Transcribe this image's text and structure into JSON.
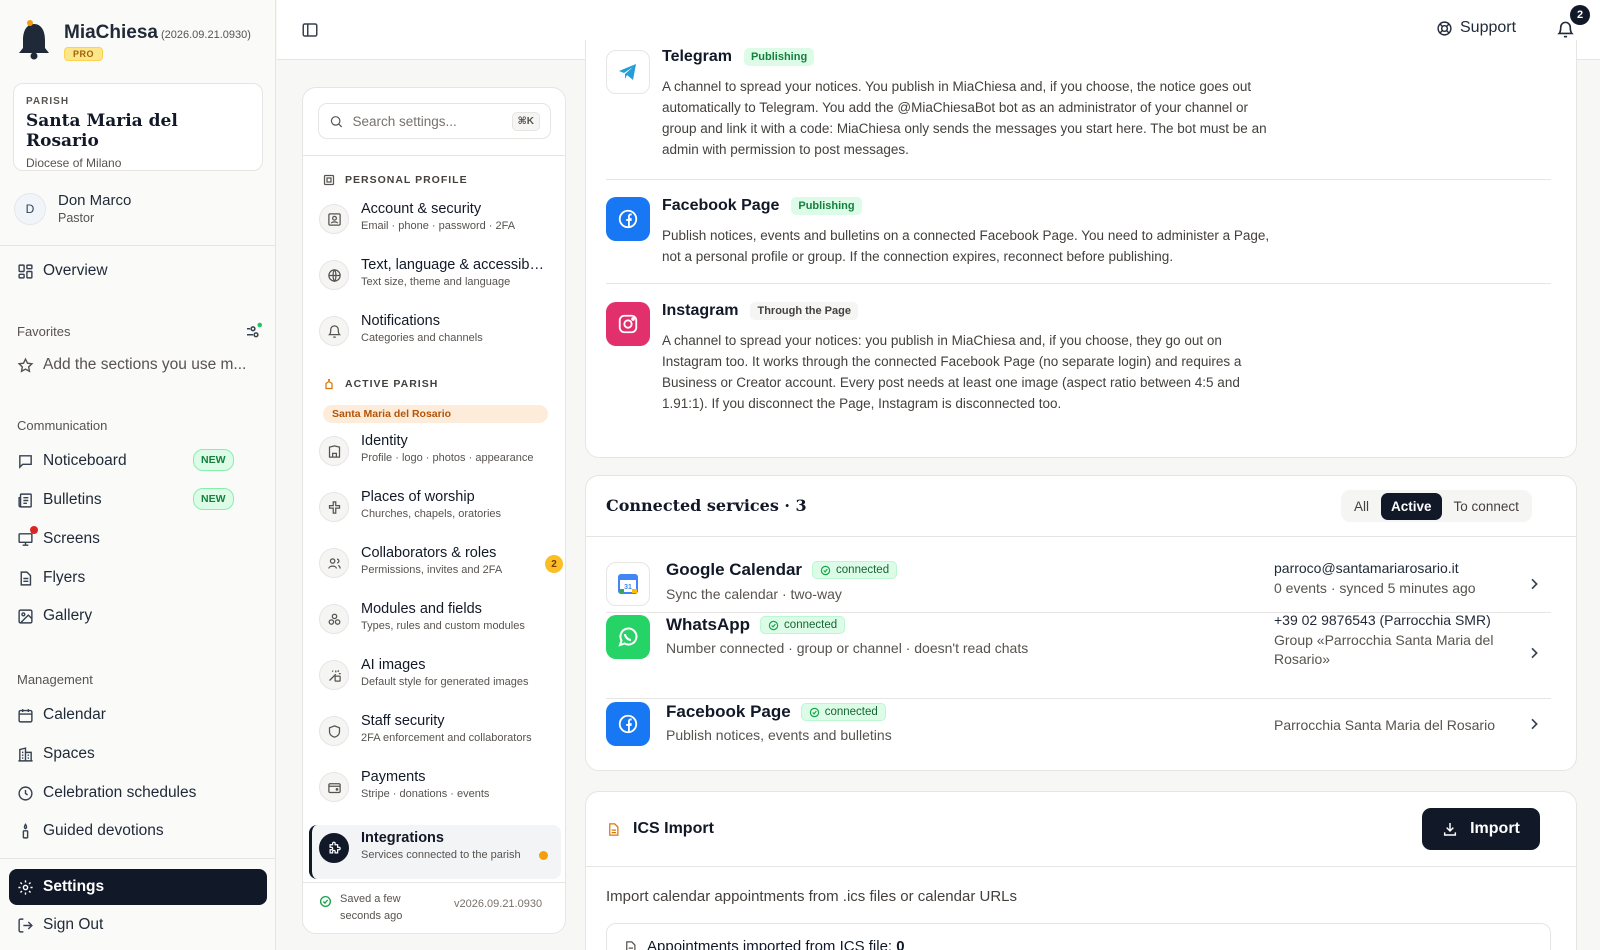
{
  "app": {
    "name": "MiaChiesa",
    "version": "(2026.09.21.0930)",
    "plan": "PRO"
  },
  "parish": {
    "label": "PARISH",
    "name": "Santa Maria del Rosario",
    "diocese": "Diocese of Milano"
  },
  "user": {
    "initial": "D",
    "name": "Don Marco",
    "role": "Pastor"
  },
  "nav": {
    "overview": "Overview",
    "favorites_label": "Favorites",
    "favorites_hint": "Add the sections you use m...",
    "communication_label": "Communication",
    "communication": [
      {
        "label": "Noticeboard",
        "badge": "NEW"
      },
      {
        "label": "Bulletins",
        "badge": "NEW"
      },
      {
        "label": "Screens"
      },
      {
        "label": "Flyers"
      },
      {
        "label": "Gallery"
      }
    ],
    "management_label": "Management",
    "management": [
      {
        "label": "Calendar"
      },
      {
        "label": "Spaces"
      },
      {
        "label": "Celebration schedules"
      },
      {
        "label": "Guided devotions"
      }
    ],
    "settings": "Settings",
    "signout": "Sign Out"
  },
  "topbar": {
    "support": "Support",
    "notifications_count": "2"
  },
  "settings_panel": {
    "search_placeholder": "Search settings...",
    "shortcut": "⌘K",
    "personal_label": "PERSONAL PROFILE",
    "personal": [
      {
        "title": "Account & security",
        "sub": "Email · phone · password · 2FA"
      },
      {
        "title": "Text, language & accessibility",
        "sub": "Text size, theme and language"
      },
      {
        "title": "Notifications",
        "sub": "Categories and channels"
      }
    ],
    "parish_label": "ACTIVE PARISH",
    "parish_tag": "Santa Maria del Rosario",
    "parish_items": [
      {
        "title": "Identity",
        "sub": "Profile · logo · photos · appearance"
      },
      {
        "title": "Places of worship",
        "sub": "Churches, chapels, oratories"
      },
      {
        "title": "Collaborators & roles",
        "sub": "Permissions, invites and 2FA",
        "count": "2"
      },
      {
        "title": "Modules and fields",
        "sub": "Types, rules and custom modules"
      },
      {
        "title": "AI images",
        "sub": "Default style for generated images"
      },
      {
        "title": "Staff security",
        "sub": "2FA enforcement and collaborators"
      },
      {
        "title": "Payments",
        "sub": "Stripe · donations · events"
      },
      {
        "title": "Integrations",
        "sub": "Services connected to the parish"
      }
    ],
    "saved_line1": "Saved a few",
    "saved_line2": "seconds ago",
    "version": "v2026.09.21.0930"
  },
  "channels": [
    {
      "name": "Telegram",
      "badge": "Publishing",
      "desc": "A channel to spread your notices. You publish in MiaChiesa and, if you choose, the notice goes out automatically to Telegram. You add the @MiaChiesaBot bot as an administrator of your channel or group and link it with a code: MiaChiesa only sends the messages you start here. The bot must be an admin with permission to post messages."
    },
    {
      "name": "Facebook Page",
      "badge": "Publishing",
      "desc": "Publish notices, events and bulletins on a connected Facebook Page. You need to administer a Page, not a personal profile or group. If the connection expires, reconnect before publishing."
    },
    {
      "name": "Instagram",
      "badge": "Through the Page",
      "desc": "A channel to spread your notices: you publish in MiaChiesa and, if you choose, they go out on Instagram too. It works through the connected Facebook Page (no separate login) and requires a Business or Creator account. Every post needs at least one image (aspect ratio between 4:5 and 1.91:1). If you disconnect the Page, Instagram is disconnected too."
    }
  ],
  "connected": {
    "title": "Connected services · 3",
    "filters": [
      "All",
      "Active",
      "To connect"
    ],
    "services": [
      {
        "name": "Google Calendar",
        "status": "connected",
        "sub": "Sync the calendar · two-way",
        "right1": "parroco@santamariarosario.it",
        "right2": "0 events · synced 5 minutes ago"
      },
      {
        "name": "WhatsApp",
        "status": "connected",
        "sub": "Number connected · group or channel · doesn't read chats",
        "right1": "+39 02 9876543 (Parrocchia SMR)",
        "right2": "Group «Parrocchia Santa Maria del Rosario»"
      },
      {
        "name": "Facebook Page",
        "status": "connected",
        "sub": "Publish notices, events and bulletins",
        "right2": "Parrocchia Santa Maria del Rosario"
      }
    ]
  },
  "ics": {
    "title": "ICS Import",
    "button": "Import",
    "desc": "Import calendar appointments from .ics files or calendar URLs",
    "box_label": "Appointments imported from ICS file:",
    "box_count": "0"
  },
  "colors": {
    "dark": "#111827",
    "accent_orange": "#f59e0b",
    "green": "#16a34a",
    "facebook": "#1877f2",
    "whatsapp": "#25d366",
    "instagram": "#e1306c"
  }
}
